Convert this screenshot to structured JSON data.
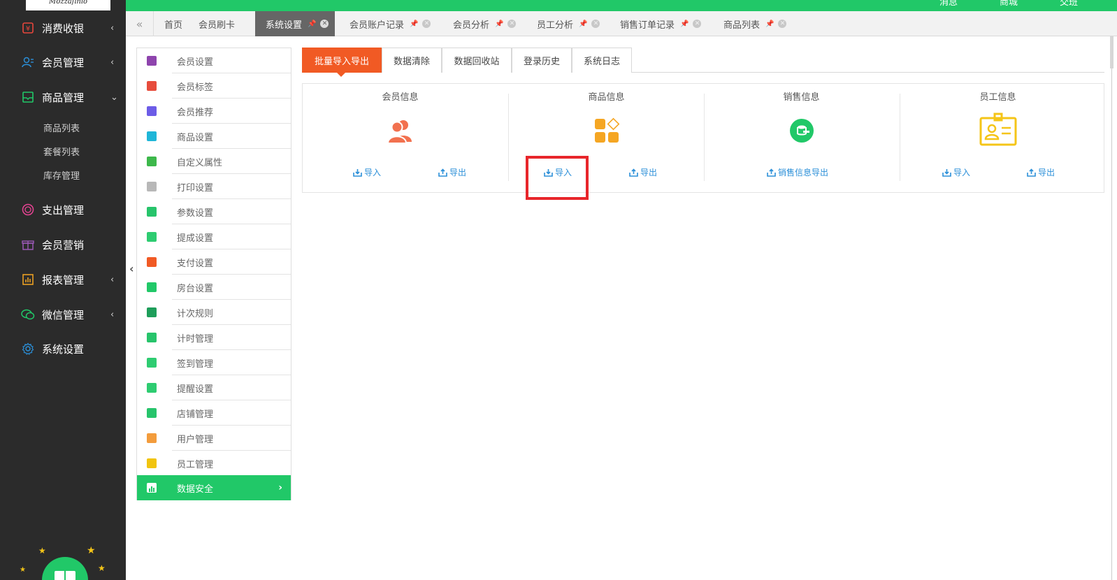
{
  "app": {
    "logo_text": "Mozzafinio"
  },
  "top_links": [
    "消息",
    "商城",
    "交班"
  ],
  "sidebar": {
    "items": [
      {
        "label": "消费收银",
        "icon": "cashier-icon",
        "arrow": "‹"
      },
      {
        "label": "会员管理",
        "icon": "member-icon",
        "arrow": "‹"
      },
      {
        "label": "商品管理",
        "icon": "product-icon",
        "arrow": "⌄"
      },
      {
        "label": "支出管理",
        "icon": "expense-icon",
        "arrow": ""
      },
      {
        "label": "会员营销",
        "icon": "gift-icon",
        "arrow": ""
      },
      {
        "label": "报表管理",
        "icon": "report-icon",
        "arrow": "‹"
      },
      {
        "label": "微信管理",
        "icon": "wechat-icon",
        "arrow": "‹"
      },
      {
        "label": "系统设置",
        "icon": "gear-icon",
        "arrow": ""
      }
    ],
    "sub_items": [
      "商品列表",
      "套餐列表",
      "库存管理"
    ]
  },
  "tabs": [
    {
      "label": "首页"
    },
    {
      "label": "会员刷卡"
    },
    {
      "label": "系统设置",
      "active": true
    },
    {
      "label": "会员账户记录"
    },
    {
      "label": "会员分析"
    },
    {
      "label": "员工分析"
    },
    {
      "label": "销售订单记录"
    },
    {
      "label": "商品列表"
    }
  ],
  "settings_menu": [
    {
      "label": "会员设置",
      "color": "#8e44ad"
    },
    {
      "label": "会员标签",
      "color": "#e74c3c"
    },
    {
      "label": "会员推荐",
      "color": "#6c5ce7"
    },
    {
      "label": "商品设置",
      "color": "#1fb6d8"
    },
    {
      "label": "自定义属性",
      "color": "#3db84b"
    },
    {
      "label": "打印设置",
      "color": "#b8b8b8"
    },
    {
      "label": "参数设置",
      "color": "#27c46b"
    },
    {
      "label": "提成设置",
      "color": "#2ecc71"
    },
    {
      "label": "支付设置",
      "color": "#f15a24"
    },
    {
      "label": "房台设置",
      "color": "#21c868"
    },
    {
      "label": "计次规则",
      "color": "#1e9e5a"
    },
    {
      "label": "计时管理",
      "color": "#27c46b"
    },
    {
      "label": "签到管理",
      "color": "#2ecc71"
    },
    {
      "label": "提醒设置",
      "color": "#2ecc71"
    },
    {
      "label": "店铺管理",
      "color": "#27c46b"
    },
    {
      "label": "用户管理",
      "color": "#f39c3c"
    },
    {
      "label": "员工管理",
      "color": "#f1c40f"
    },
    {
      "label": "数据安全",
      "color": "#ffffff",
      "active": true
    }
  ],
  "content_tabs": [
    {
      "label": "批量导入导出",
      "active": true
    },
    {
      "label": "数据清除"
    },
    {
      "label": "数据回收站"
    },
    {
      "label": "登录历史"
    },
    {
      "label": "系统日志"
    }
  ],
  "sections": [
    {
      "title": "会员信息",
      "icon": "users-icon",
      "color": "#f2714f",
      "actions": [
        "导入",
        "导出"
      ]
    },
    {
      "title": "商品信息",
      "icon": "products-icon",
      "color": "#f5a623",
      "actions": [
        "导入",
        "导出"
      ]
    },
    {
      "title": "销售信息",
      "icon": "sales-icon",
      "color": "#21c868",
      "actions": [
        "销售信息导出"
      ]
    },
    {
      "title": "员工信息",
      "icon": "badge-icon",
      "color": "#f5c518",
      "actions": [
        "导入",
        "导出"
      ]
    }
  ],
  "colors": {
    "accent_green": "#21c868",
    "accent_orange": "#f15a24",
    "sidebar_bg": "#2b2b2b",
    "link_blue": "#2b8fd8",
    "highlight_red": "#e8262b"
  }
}
